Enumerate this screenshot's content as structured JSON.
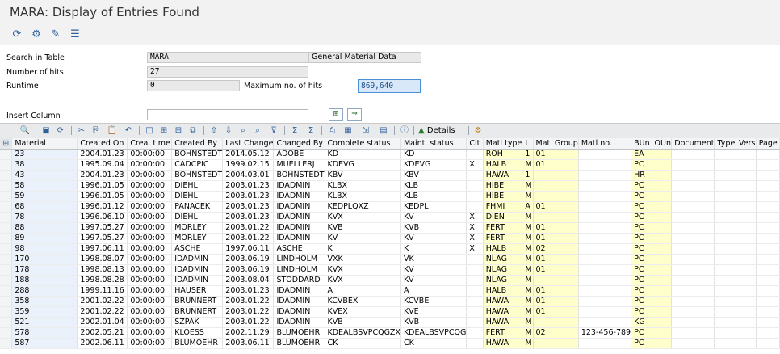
{
  "window": {
    "title": "MARA: Display of Entries Found"
  },
  "app_toolbar": {
    "icons": [
      "refresh-icon",
      "selection-options-icon",
      "execute-icon",
      "list-icon"
    ]
  },
  "selection": {
    "table_label": "Search in Table",
    "table_value": "MARA",
    "table_desc": "General Material Data",
    "hits_label": "Number of hits",
    "hits_value": "27",
    "runtime_label": "Runtime",
    "runtime_value": "0",
    "max_hits_label": "Maximum no. of hits",
    "max_hits_value": "869,640",
    "insert_label": "Insert Column",
    "insert_value": ""
  },
  "grid_toolbar": {
    "details_label": "Details"
  },
  "columns": [
    "Material",
    "Created On",
    "Crea. time",
    "Created By",
    "Last Change",
    "Changed By",
    "Complete status",
    "Maint. status",
    "Clt",
    "Matl type",
    "I",
    "Matl Group",
    "Matl no.",
    "BUn",
    "OUn",
    "Document",
    "Type",
    "Vers",
    "Page"
  ],
  "rows": [
    [
      "23",
      "2004.01.23",
      "00:00:00",
      "BOHNSTEDT",
      "2014.05.12",
      "ADOBE",
      "KD",
      "KD",
      "",
      "ROH",
      "1",
      "01",
      "",
      "EA",
      "",
      "",
      "",
      "",
      ""
    ],
    [
      "38",
      "1995.09.04",
      "00:00:00",
      "CADCPIC",
      "1999.02.15",
      "MUELLERJ",
      "KDEVG",
      "KDEVG",
      "X",
      "HALB",
      "M",
      "01",
      "",
      "PC",
      "",
      "",
      "",
      "",
      ""
    ],
    [
      "43",
      "2004.01.23",
      "00:00:00",
      "BOHNSTEDT",
      "2004.03.01",
      "BOHNSTEDT",
      "KBV",
      "KBV",
      "",
      "HAWA",
      "1",
      "",
      "",
      "HR",
      "",
      "",
      "",
      "",
      ""
    ],
    [
      "58",
      "1996.01.05",
      "00:00:00",
      "DIEHL",
      "2003.01.23",
      "IDADMIN",
      "KLBX",
      "KLB",
      "",
      "HIBE",
      "M",
      "",
      "",
      "PC",
      "",
      "",
      "",
      "",
      ""
    ],
    [
      "59",
      "1996.01.05",
      "00:00:00",
      "DIEHL",
      "2003.01.23",
      "IDADMIN",
      "KLBX",
      "KLB",
      "",
      "HIBE",
      "M",
      "",
      "",
      "PC",
      "",
      "",
      "",
      "",
      ""
    ],
    [
      "68",
      "1996.01.12",
      "00:00:00",
      "PANACEK",
      "2003.01.23",
      "IDADMIN",
      "KEDPLQXZ",
      "KEDPL",
      "",
      "FHMI",
      "A",
      "01",
      "",
      "PC",
      "",
      "",
      "",
      "",
      ""
    ],
    [
      "78",
      "1996.06.10",
      "00:00:00",
      "DIEHL",
      "2003.01.23",
      "IDADMIN",
      "KVX",
      "KV",
      "X",
      "DIEN",
      "M",
      "",
      "",
      "PC",
      "",
      "",
      "",
      "",
      ""
    ],
    [
      "88",
      "1997.05.27",
      "00:00:00",
      "MORLEY",
      "2003.01.22",
      "IDADMIN",
      "KVB",
      "KVB",
      "X",
      "FERT",
      "M",
      "01",
      "",
      "PC",
      "",
      "",
      "",
      "",
      ""
    ],
    [
      "89",
      "1997.05.27",
      "00:00:00",
      "MORLEY",
      "2003.01.22",
      "IDADMIN",
      "KV",
      "KV",
      "X",
      "FERT",
      "M",
      "01",
      "",
      "PC",
      "",
      "",
      "",
      "",
      ""
    ],
    [
      "98",
      "1997.06.11",
      "00:00:00",
      "ASCHE",
      "1997.06.11",
      "ASCHE",
      "K",
      "K",
      "X",
      "HALB",
      "M",
      "02",
      "",
      "PC",
      "",
      "",
      "",
      "",
      ""
    ],
    [
      "170",
      "1998.08.07",
      "00:00:00",
      "IDADMIN",
      "2003.06.19",
      "LINDHOLM",
      "VXK",
      "VK",
      "",
      "NLAG",
      "M",
      "01",
      "",
      "PC",
      "",
      "",
      "",
      "",
      ""
    ],
    [
      "178",
      "1998.08.13",
      "00:00:00",
      "IDADMIN",
      "2003.06.19",
      "LINDHOLM",
      "KVX",
      "KV",
      "",
      "NLAG",
      "M",
      "01",
      "",
      "PC",
      "",
      "",
      "",
      "",
      ""
    ],
    [
      "188",
      "1998.08.28",
      "00:00:00",
      "IDADMIN",
      "2003.08.04",
      "STODDARD",
      "KVX",
      "KV",
      "",
      "NLAG",
      "M",
      "",
      "",
      "PC",
      "",
      "",
      "",
      "",
      ""
    ],
    [
      "288",
      "1999.11.16",
      "00:00:00",
      "HAUSER",
      "2003.01.23",
      "IDADMIN",
      "A",
      "A",
      "",
      "HALB",
      "M",
      "01",
      "",
      "PC",
      "",
      "",
      "",
      "",
      ""
    ],
    [
      "358",
      "2001.02.22",
      "00:00:00",
      "BRUNNERT",
      "2003.01.22",
      "IDADMIN",
      "KCVBEX",
      "KCVBE",
      "",
      "HAWA",
      "M",
      "01",
      "",
      "PC",
      "",
      "",
      "",
      "",
      ""
    ],
    [
      "359",
      "2001.02.22",
      "00:00:00",
      "BRUNNERT",
      "2003.01.22",
      "IDADMIN",
      "KVEX",
      "KVE",
      "",
      "HAWA",
      "M",
      "01",
      "",
      "PC",
      "",
      "",
      "",
      "",
      ""
    ],
    [
      "521",
      "2002.01.04",
      "00:00:00",
      "SZPAK",
      "2003.01.22",
      "IDADMIN",
      "KVB",
      "KVB",
      "",
      "HAWA",
      "M",
      "",
      "",
      "KG",
      "",
      "",
      "",
      "",
      ""
    ],
    [
      "578",
      "2002.05.21",
      "00:00:00",
      "KLOESS",
      "2002.11.29",
      "BLUMOEHR",
      "KDEALBSVPCQGZX",
      "KDEALBSVPCQG",
      "",
      "FERT",
      "M",
      "02",
      "123-456-789",
      "PC",
      "",
      "",
      "",
      "",
      ""
    ],
    [
      "587",
      "2002.06.11",
      "00:00:00",
      "BLUMOEHR",
      "2003.06.11",
      "BLUMOEHR",
      "CK",
      "CK",
      "",
      "HAWA",
      "M",
      "",
      "",
      "PC",
      "",
      "",
      "",
      "",
      ""
    ]
  ]
}
